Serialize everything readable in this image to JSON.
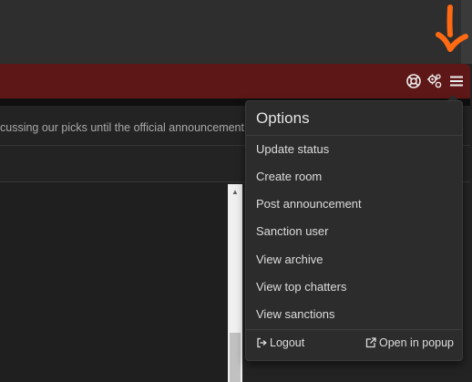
{
  "header": {
    "accent_color": "#5e1717",
    "icons": [
      "lifebuoy-icon",
      "gears-icon",
      "hamburger-menu-icon"
    ]
  },
  "annotation": {
    "arrow_color": "#ff6a13"
  },
  "announcement": {
    "text": "cussing our picks until the official announcement h"
  },
  "options_menu": {
    "title": "Options",
    "items": [
      {
        "label": "Update status"
      },
      {
        "label": "Create room"
      },
      {
        "label": "Post announcement"
      },
      {
        "label": "Sanction user"
      },
      {
        "label": "View archive"
      },
      {
        "label": "View top chatters"
      },
      {
        "label": "View sanctions"
      }
    ],
    "footer": {
      "logout_label": "Logout",
      "popup_label": "Open in popup",
      "logout_icon": "sign-out-icon",
      "popup_icon": "external-link-icon"
    }
  }
}
